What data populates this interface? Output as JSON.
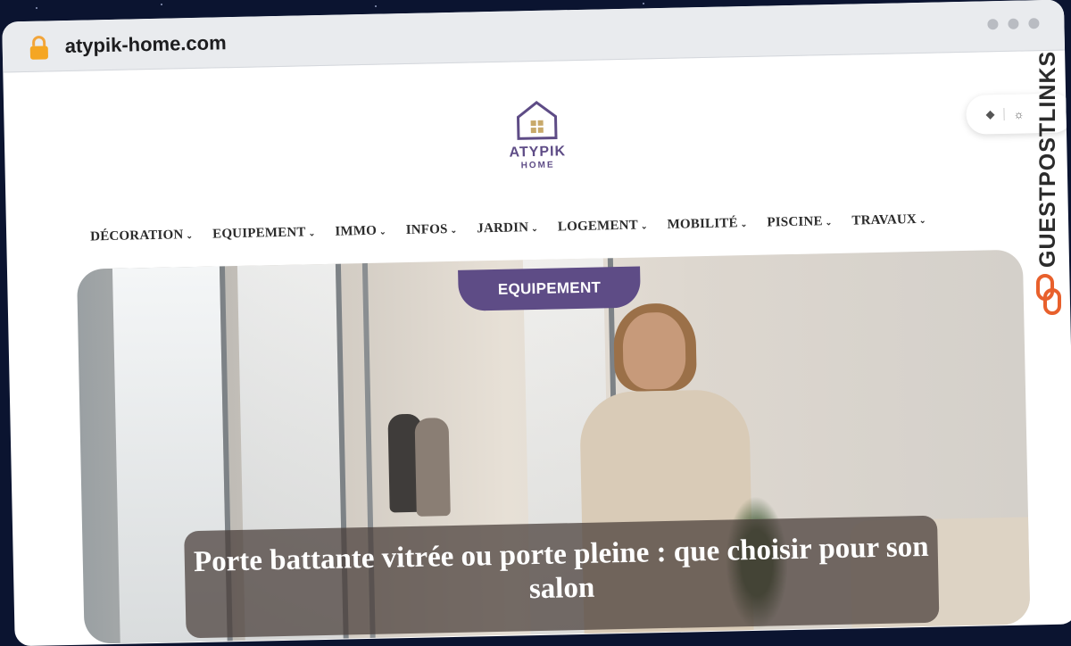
{
  "browser": {
    "url": "atypik-home.com",
    "lock_icon": "lock-icon",
    "window_dots": [
      "dot",
      "dot",
      "dot"
    ]
  },
  "site": {
    "logo_name": "ATYPIK",
    "logo_sub": "HOME",
    "logo_icon": "house-icon",
    "theme_toggle": {
      "left_icon": "diamond-icon",
      "right_icon": "sun-icon"
    }
  },
  "nav": {
    "items": [
      {
        "label": "DÉCORATION"
      },
      {
        "label": "EQUIPEMENT"
      },
      {
        "label": "IMMO"
      },
      {
        "label": "INFOS"
      },
      {
        "label": "JARDIN"
      },
      {
        "label": "LOGEMENT"
      },
      {
        "label": "MOBILITÉ"
      },
      {
        "label": "PISCINE"
      },
      {
        "label": "TRAVAUX"
      }
    ]
  },
  "hero": {
    "category": "EQUIPEMENT",
    "title": "Porte battante vitrée ou porte pleine : que choisir pour son salon"
  },
  "side": {
    "brand": "GUESTPOSTLINKS",
    "brand_color": "#e8602c"
  },
  "colors": {
    "accent": "#5e4c86"
  }
}
